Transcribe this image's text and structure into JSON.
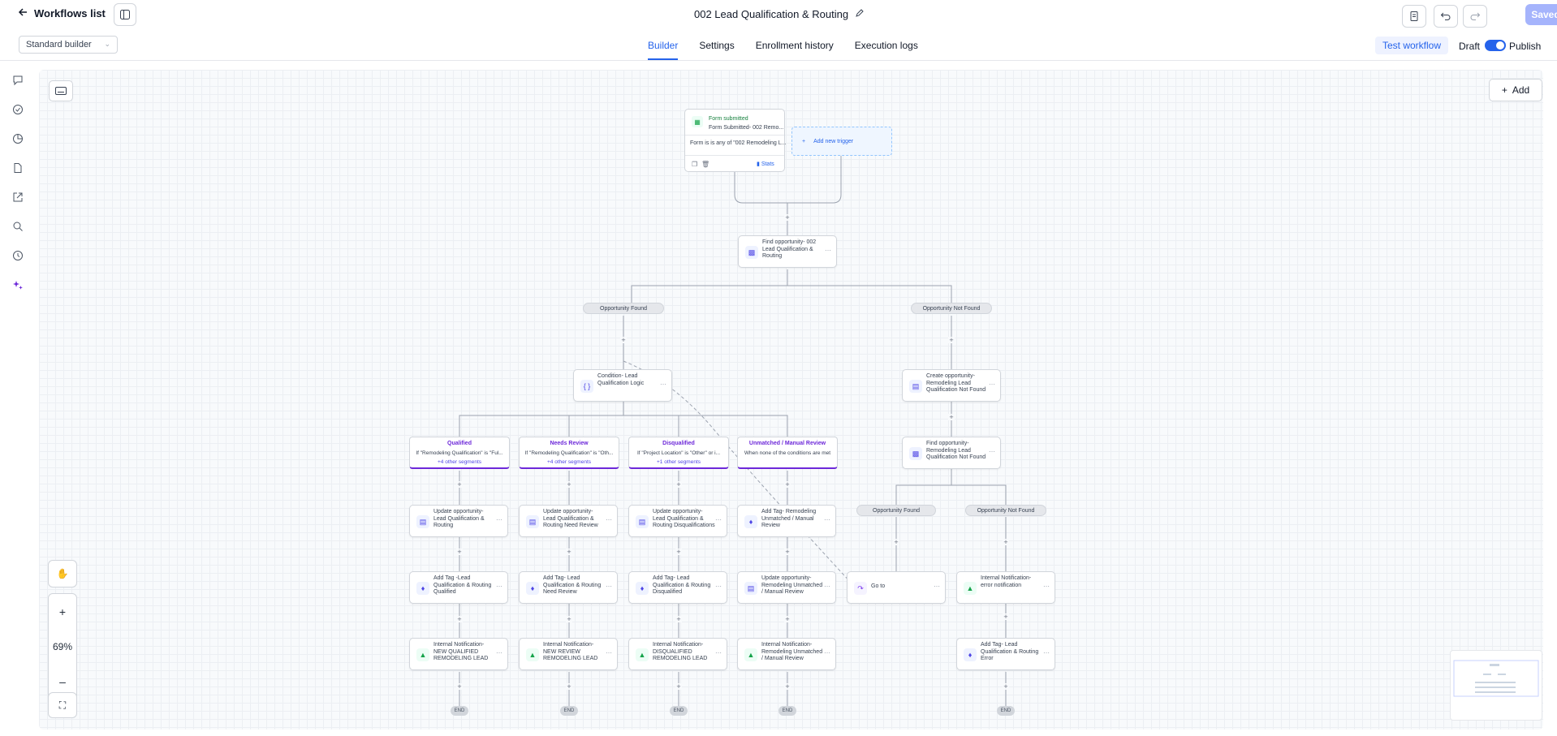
{
  "header": {
    "back_label": "Workflows list",
    "title": "002 Lead Qualification & Routing",
    "saved_label": "Saved"
  },
  "subbar": {
    "builder_mode": "Standard builder",
    "tabs": [
      "Builder",
      "Settings",
      "Enrollment history",
      "Execution logs"
    ],
    "active_tab": "Builder",
    "test_label": "Test workflow",
    "draft_label": "Draft",
    "publish_label": "Publish"
  },
  "canvas": {
    "add_label": "Add",
    "zoom_level": "69%",
    "trigger": {
      "type_label": "Form submitted",
      "name": "Form Submitted- 002 Remo...",
      "condition": "Form is is any of \"002 Remodeling L...",
      "stats_label": "Stats"
    },
    "add_trigger_label": "Add new trigger",
    "nodes": {
      "find_opp": "Find opportunity- 002 Lead Qualification & Routing",
      "condition": "Condition- Lead Qualification Logic",
      "create_opp": "Create opportunity- Remodeling Lead Qualification Not Found",
      "find_opp2": "Find opportunity- Remodeling Lead Qualification Not Found",
      "upd_qualified": "Update opportunity- Lead Qualification & Routing",
      "upd_review": "Update opportunity- Lead Qualification & Routing Need Review",
      "upd_disq": "Update opportunity- Lead Qualification & Routing Disqualifications",
      "tag_unmatched": "Add Tag- Remodeling Unmatched / Manual Review",
      "tag_qualified": "Add Tag -Lead Qualification & Routing Qualified",
      "tag_review": "Add Tag- Lead Qualification & Routing Need Review",
      "tag_disq": "Add Tag- Lead Qualification & Routing Disqualified",
      "upd_unmatched": "Update opportunity- Remodeling Unmatched / Manual Review",
      "goto": "Go to",
      "notif_error": "Internal Notification- error notification",
      "notif_qualified": "Internal Notification- NEW QUALIFIED REMODELING LEAD",
      "notif_review": "Internal Notification- NEW REVIEW REMODELING LEAD",
      "notif_disq": "Internal Notification- DISQUALIFIED REMODELING LEAD",
      "notif_unmatched": "Internal Notification- Remodeling Unmatched / Manual Review",
      "tag_error": "Add Tag- Lead Qualification & Routing Error"
    },
    "pills": {
      "found": "Opportunity Found",
      "not_found": "Opportunity Not Found"
    },
    "branches": [
      {
        "title": "Qualified",
        "cond": "If \"Remodeling Qualification\" is \"Ful...",
        "sub": "+4 other segments"
      },
      {
        "title": "Needs Review",
        "cond": "If \"Remodeling Qualification\" is \"Oth...",
        "sub": "+4 other segments"
      },
      {
        "title": "Disqualified",
        "cond": "If \"Project Location\" is \"Other\" or i...",
        "sub": "+1 other segments"
      },
      {
        "title": "Unmatched / Manual Review",
        "cond": "When none of the conditions are met",
        "sub": ""
      }
    ],
    "end_label": "END"
  }
}
